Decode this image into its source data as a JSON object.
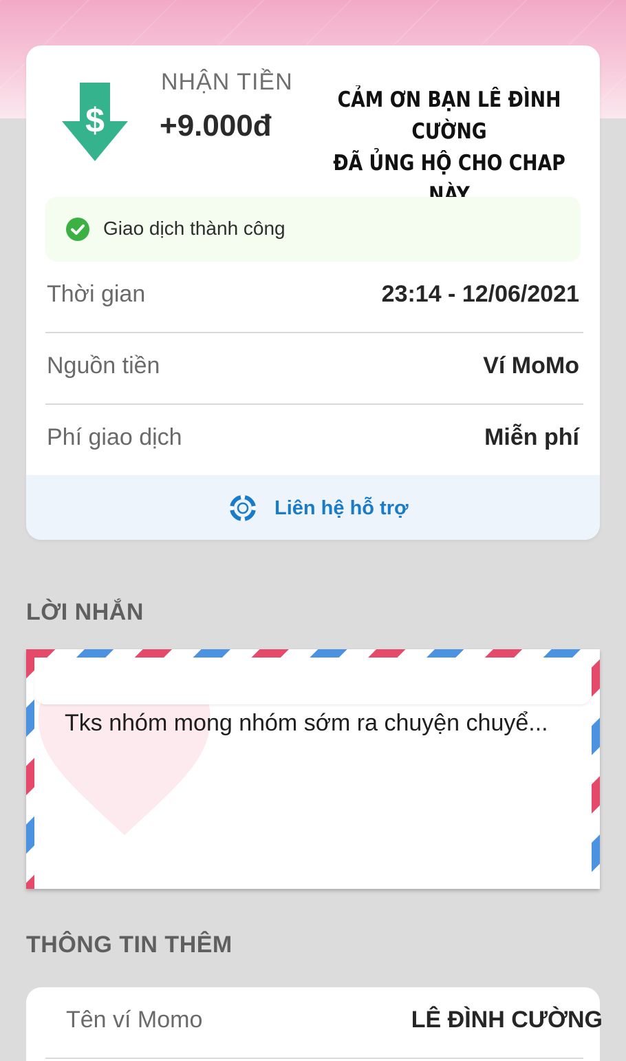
{
  "header": {
    "type_label": "NHẬN TIỀN",
    "amount": "+9.000đ",
    "thanks_line1": "CẢM ƠN BẠN LÊ ĐÌNH CƯỜNG",
    "thanks_line2": "ĐÃ ỦNG HỘ CHO CHAP NÀY",
    "icon": "download-dollar-icon",
    "icon_color": "#35b38c"
  },
  "status": {
    "text": "Giao dịch thành công",
    "icon": "check-circle-icon",
    "color": "#3cb043"
  },
  "details": [
    {
      "label": "Thời gian",
      "value": "23:14 - 12/06/2021"
    },
    {
      "label": "Nguồn tiền",
      "value": "Ví MoMo"
    },
    {
      "label": "Phí giao dịch",
      "value": "Miễn phí"
    }
  ],
  "support": {
    "label": "Liên hệ hỗ trợ",
    "icon": "lifebuoy-icon",
    "color": "#1a7cc9"
  },
  "message_section": {
    "title": "LỜI NHẮN",
    "text": "Tks nhóm mong nhóm sớm ra chuyện chuyể..."
  },
  "extra_section": {
    "title": "THÔNG TIN THÊM",
    "rows": [
      {
        "label": "Tên ví Momo",
        "value": "LÊ ĐÌNH CƯỜNG"
      }
    ]
  },
  "colors": {
    "brand_pink": "#f2a9c6",
    "airmail_red": "#e64a6a",
    "airmail_blue": "#4b93e0"
  }
}
